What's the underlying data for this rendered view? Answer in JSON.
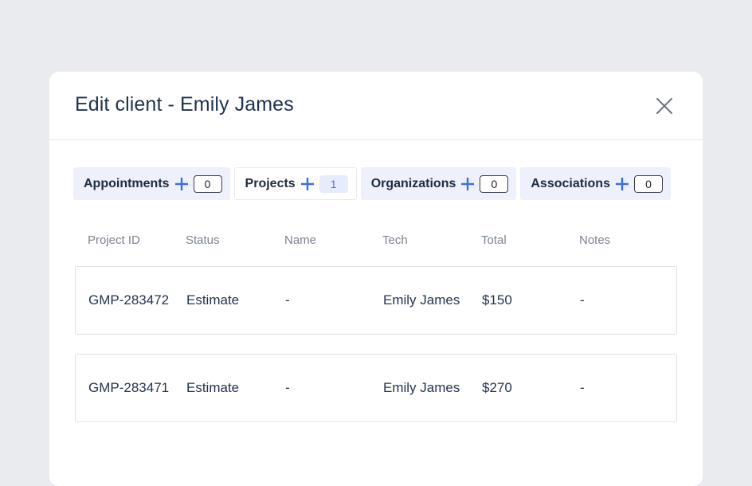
{
  "modal": {
    "title": "Edit client - Emily James",
    "close_icon": "close-icon"
  },
  "tabs": [
    {
      "label": "Appointments",
      "count": "0",
      "active": false
    },
    {
      "label": "Projects",
      "count": "1",
      "active": true
    },
    {
      "label": "Organizations",
      "count": "0",
      "active": false
    },
    {
      "label": "Associations",
      "count": "0",
      "active": false
    }
  ],
  "table": {
    "headers": [
      "Project ID",
      "Status",
      "Name",
      "Tech",
      "Total",
      "Notes"
    ],
    "rows": [
      [
        "GMP-283472",
        "Estimate",
        "-",
        "Emily James",
        "$150",
        "-"
      ],
      [
        "GMP-283471",
        "Estimate",
        "-",
        "Emily James",
        "$270",
        "-"
      ]
    ]
  },
  "colors": {
    "accent": "#3b6fe0",
    "title": "#1f3352",
    "background": "#e9ebee"
  }
}
